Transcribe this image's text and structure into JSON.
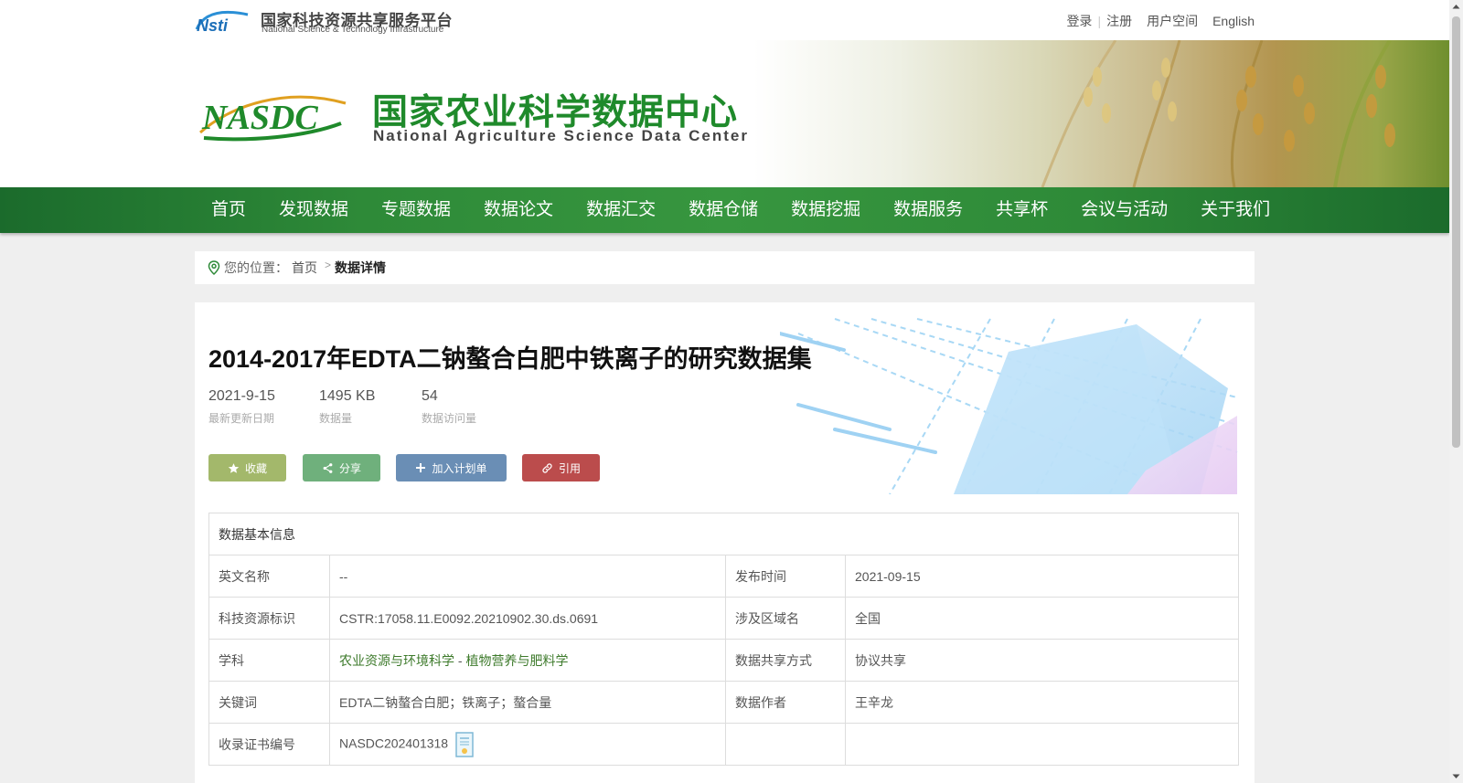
{
  "topbar": {
    "platform_cn": "国家科技资源共享服务平台",
    "platform_en": "National Science & Technology Infrastructure",
    "links": [
      "登录",
      "注册",
      "用户空间",
      "English"
    ]
  },
  "banner": {
    "title_cn": "国家农业科学数据中心",
    "title_en": "National Agriculture Science Data Center"
  },
  "nav": {
    "items": [
      "首页",
      "发现数据",
      "专题数据",
      "数据论文",
      "数据汇交",
      "数据仓储",
      "数据挖掘",
      "数据服务",
      "共享杯",
      "会议与活动",
      "关于我们"
    ]
  },
  "breadcrumb": {
    "label": "您的位置：",
    "home": "首页",
    "current": "数据详情"
  },
  "dataset": {
    "title": "2014-2017年EDTA二钠螯合白肥中铁离子的研究数据集",
    "stats": [
      {
        "value": "2021-9-15",
        "label": "最新更新日期"
      },
      {
        "value": "1495 KB",
        "label": "数据量"
      },
      {
        "value": "54",
        "label": "数据访问量"
      }
    ],
    "buttons": {
      "favorite": "收藏",
      "share": "分享",
      "plan": "加入计划单",
      "cite": "引用"
    }
  },
  "info_table": {
    "header": "数据基本信息",
    "rows": [
      {
        "k1": "英文名称",
        "v1": "--",
        "k2": "发布时间",
        "v2": "2021-09-15"
      },
      {
        "k1": "科技资源标识",
        "v1": "CSTR:17058.11.E0092.20210902.30.ds.0691",
        "k2": "涉及区域名",
        "v2": "全国"
      },
      {
        "k1": "学科",
        "v1a": "农业资源与环境科学",
        "v1sep": " - ",
        "v1b": "植物营养与肥料学",
        "k2": "数据共享方式",
        "v2": "协议共享"
      },
      {
        "k1": "关键词",
        "v1": "EDTA二钠螯合白肥；铁离子；螯合量",
        "k2": "数据作者",
        "v2": "王辛龙"
      },
      {
        "k1": "收录证书编号",
        "v1": "NASDC202401318",
        "k2": "",
        "v2": ""
      }
    ]
  },
  "colors": {
    "nav_green": "#2e8a38",
    "brand_green": "#1f8a2b",
    "link_green": "#3d7a2b",
    "btn_favorite": "#a3b86b",
    "btn_share": "#6fb07c",
    "btn_plan": "#6a8eb5",
    "btn_cite": "#bb4c4c"
  },
  "icons": [
    "location-pin-icon",
    "star-icon",
    "share-icon",
    "plus-icon",
    "link-icon",
    "certificate-icon"
  ]
}
